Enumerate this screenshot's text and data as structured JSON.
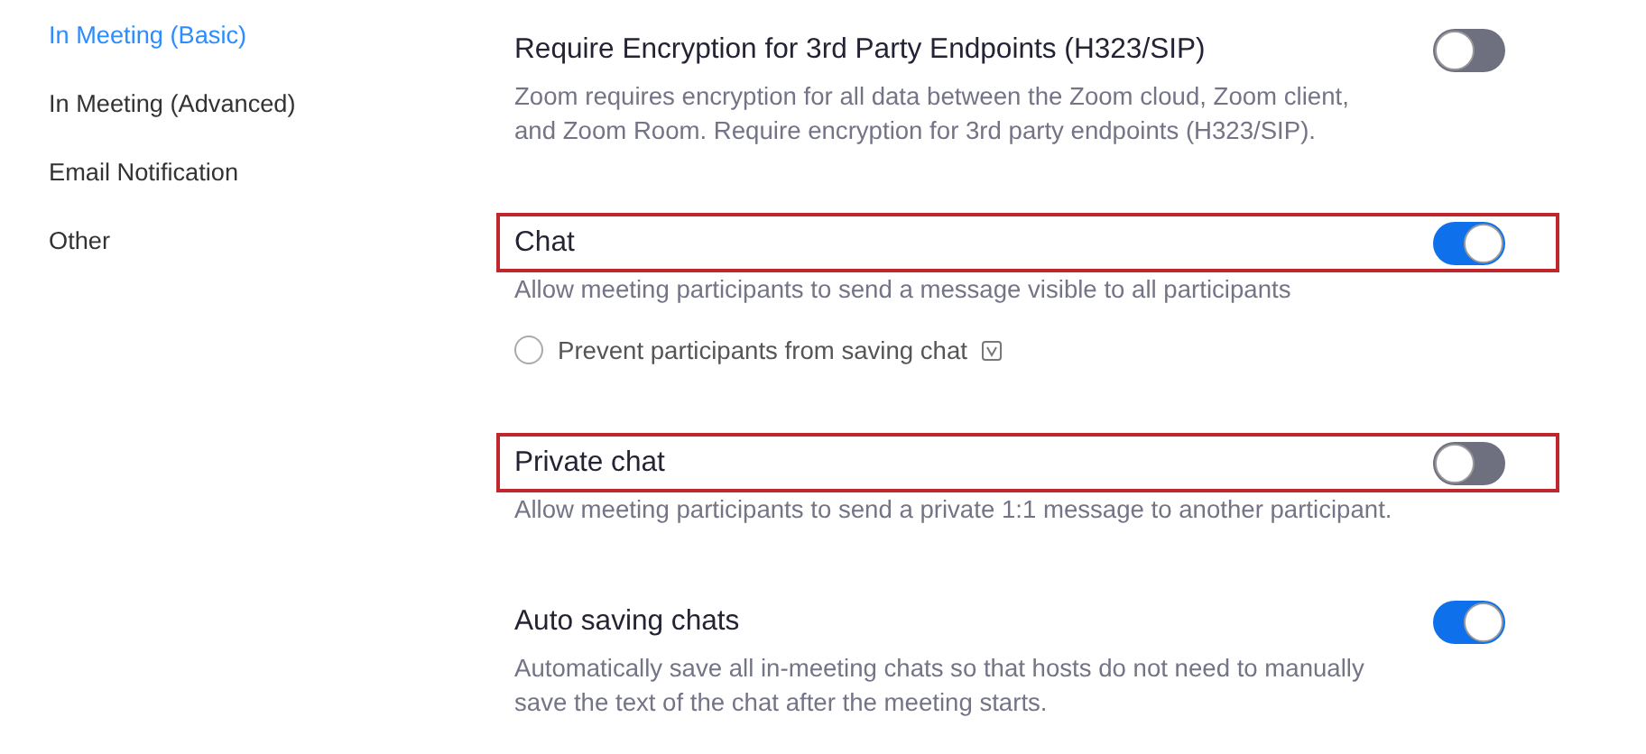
{
  "sidebar": {
    "items": [
      {
        "label": "In Meeting (Basic)",
        "selected": true
      },
      {
        "label": "In Meeting (Advanced)",
        "selected": false
      },
      {
        "label": "Email Notification",
        "selected": false
      },
      {
        "label": "Other",
        "selected": false
      }
    ]
  },
  "settings": [
    {
      "title": "Require Encryption for 3rd Party Endpoints (H323/SIP)",
      "description": "Zoom requires encryption for all data between the Zoom cloud, Zoom client, and Zoom Room. Require encryption for 3rd party endpoints (H323/SIP).",
      "on": false,
      "highlighted": false
    },
    {
      "title": "Chat",
      "description": "Allow meeting participants to send a message visible to all participants",
      "on": true,
      "highlighted": true,
      "option": {
        "label": "Prevent participants from saving chat",
        "checked": false
      }
    },
    {
      "title": "Private chat",
      "description": "Allow meeting participants to send a private 1:1 message to another participant.",
      "on": false,
      "highlighted": true
    },
    {
      "title": "Auto saving chats",
      "description": "Automatically save all in-meeting chats so that hosts do not need to manually save the text of the chat after the meeting starts.",
      "on": true,
      "highlighted": false
    }
  ]
}
